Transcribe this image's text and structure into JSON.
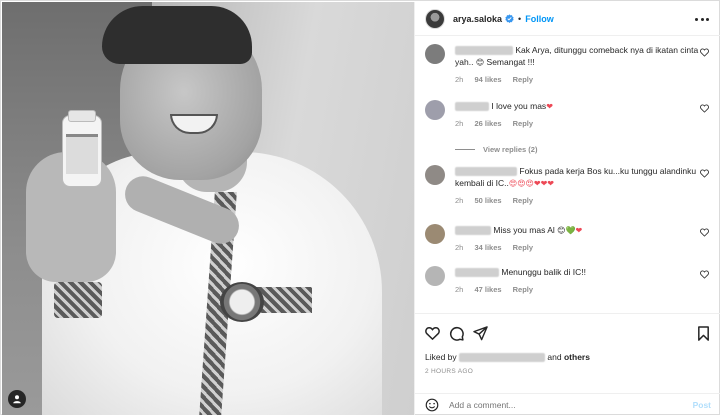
{
  "header": {
    "username": "arya.saloka",
    "separator": "•",
    "follow_label": "Follow",
    "colors": {
      "follow": "#0095f6",
      "verified": "#3897f0"
    }
  },
  "comments": [
    {
      "text": "Kak Arya, ditunggu comeback nya di ikatan cinta yah.. 😊 Semangat !!!",
      "text_main": "Kak Arya, ditunggu comeback nya di ikatan cinta yah..",
      "emoji": "😊",
      "text_tail": "Semangat !!!",
      "time": "2h",
      "likes": "94 likes",
      "reply": "Reply"
    },
    {
      "text_main": "I love you mas",
      "emoji": "❤",
      "time": "2h",
      "likes": "26 likes",
      "reply": "Reply",
      "view_replies": "View replies (2)"
    },
    {
      "text_main": "Fokus pada kerja Bos ku...ku tunggu alandinku kembali di IC..",
      "emoji": "😍😍😍❤❤❤",
      "time": "2h",
      "likes": "50 likes",
      "reply": "Reply"
    },
    {
      "text_main": "Miss you mas Al",
      "emoji_1": "😊",
      "emoji_2": "💚",
      "emoji_3": "❤",
      "time": "2h",
      "likes": "34 likes",
      "reply": "Reply"
    },
    {
      "text_main": "Menunggu balik di IC!!",
      "time": "2h",
      "likes": "47 likes",
      "reply": "Reply"
    }
  ],
  "actions": {
    "liked_by_prefix": "Liked by",
    "liked_by_and": "and",
    "liked_by_others": "others",
    "time_ago": "2 HOURS AGO"
  },
  "add_comment": {
    "placeholder": "Add a comment...",
    "post_label": "Post"
  },
  "icons": {
    "more": "more-options-icon",
    "verified": "verified-badge-icon",
    "like": "heart-icon",
    "comment": "comment-icon",
    "share": "share-icon",
    "save": "bookmark-icon",
    "emoji": "emoji-icon",
    "tag": "user-tag-icon"
  }
}
